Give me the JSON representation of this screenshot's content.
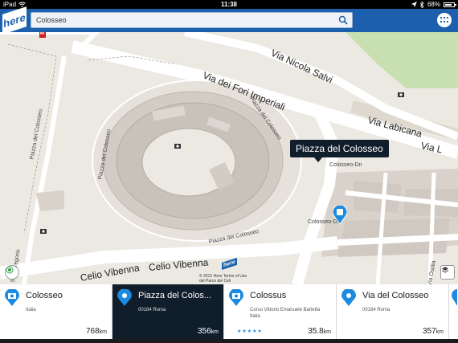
{
  "status_bar": {
    "device": "iPad",
    "time": "11:38",
    "battery": "68%",
    "battery_level": 0.68
  },
  "header": {
    "logo_text": "here",
    "search": {
      "value": "Colosseo",
      "placeholder": ""
    }
  },
  "map": {
    "callout": "Piazza del Colosseo",
    "metro_icon": "M",
    "labels": {
      "via_nicola_salvi": "Via Nicola Salvi",
      "via_dei_fori_imperiali": "Via dei Fori Imperiali",
      "via_labicana": "Via Labicana",
      "via_l": "Via L",
      "piazza_colosseo_1": "Piazza del Colosseo",
      "piazza_colosseo_2": "Piazza del Colosseo",
      "piazza_colosseo_3": "Piazza del Colosseo",
      "piazza_colosseo_4": "Piazza del Colosseo",
      "colosseo_dn": "Colosseo-Dn",
      "colosseo_ds": "Colosseo-Ds",
      "celio_vibenna_1": "Celio Vibenna",
      "celio_vibenna_2": "Celio Vibenna",
      "via_ostilia": "Via Ostilia",
      "san_gregorio": "San Gregorio"
    },
    "copyright": "© 2012 Here Terms of Use",
    "copyright_sub": "del Parco del Celi",
    "watermark": "here",
    "colors": {
      "land": "#ece9e3",
      "road": "#ffffff",
      "building": "#d8d2ca",
      "park": "#c8dfb2",
      "accent": "#1c60ad"
    }
  },
  "results": [
    {
      "title": "Colosseo",
      "subtitle": "Italia",
      "distance": "768",
      "unit": "km",
      "icon": "camera-pin-icon",
      "selected": false
    },
    {
      "title": "Piazza del Colos...",
      "subtitle": "00184 Roma",
      "distance": "356",
      "unit": "km",
      "icon": "location-pin-icon",
      "selected": true
    },
    {
      "title": "Colossus",
      "subtitle": "Corso Vittorio Emanuele Barletta\nItalia",
      "distance": "35.8",
      "unit": "km",
      "icon": "camera-pin-icon",
      "selected": false,
      "rating": "★★★★★"
    },
    {
      "title": "Via del Colosseo",
      "subtitle": "00184 Roma",
      "distance": "357",
      "unit": "km",
      "icon": "location-pin-icon",
      "selected": false
    }
  ]
}
